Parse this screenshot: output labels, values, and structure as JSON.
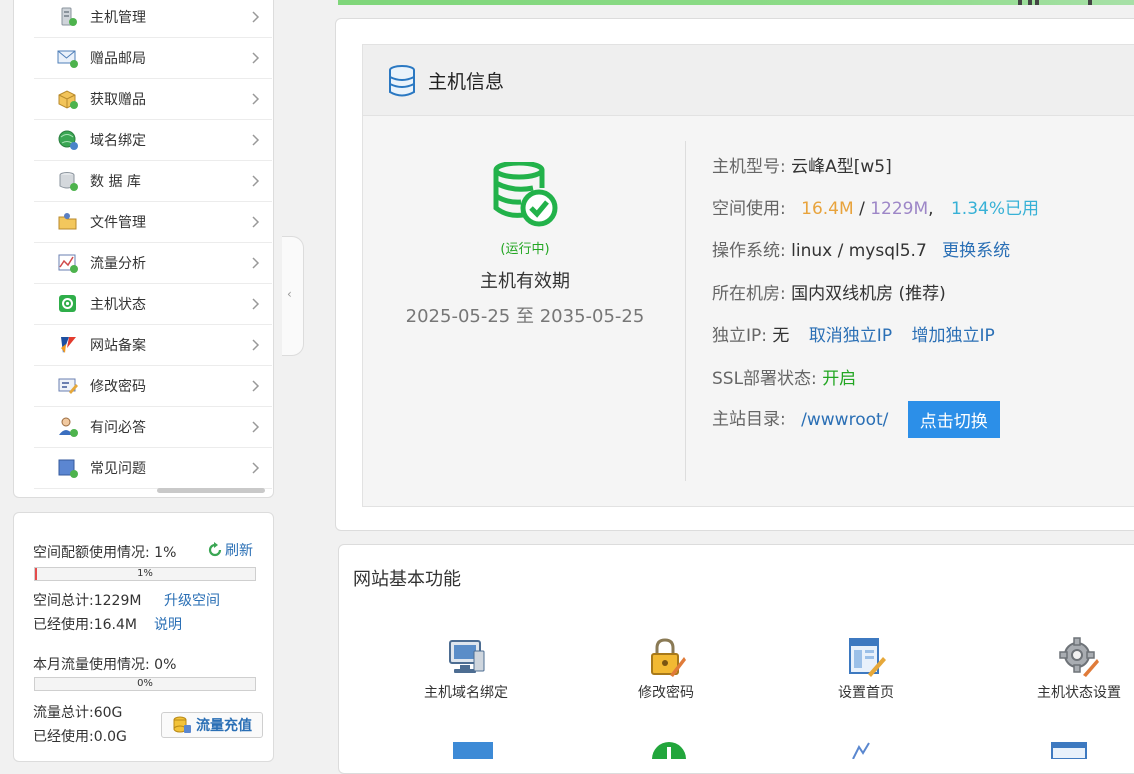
{
  "sidebar": {
    "items": [
      {
        "label": "主机管理",
        "icon": "server-icon"
      },
      {
        "label": "赠品邮局",
        "icon": "mail-icon"
      },
      {
        "label": "获取赠品",
        "icon": "gift-box-icon"
      },
      {
        "label": "域名绑定",
        "icon": "globe-icon"
      },
      {
        "label": "数 据 库",
        "icon": "database-icon"
      },
      {
        "label": "文件管理",
        "icon": "folder-icon"
      },
      {
        "label": "流量分析",
        "icon": "chart-icon"
      },
      {
        "label": "主机状态",
        "icon": "status-icon"
      },
      {
        "label": "网站备案",
        "icon": "record-icon"
      },
      {
        "label": "修改密码",
        "icon": "password-icon"
      },
      {
        "label": "有问必答",
        "icon": "support-user-icon"
      },
      {
        "label": "常见问题",
        "icon": "faq-icon"
      }
    ]
  },
  "quota": {
    "space_usage_label": "空间配额使用情况: 1%",
    "refresh_label": "刷新",
    "space_percent_text": "1%",
    "space_percent": 1,
    "space_total": "空间总计:1229M",
    "upgrade_label": "升级空间",
    "space_used": "已经使用:16.4M",
    "explain_label": "说明",
    "traffic_usage_label": "本月流量使用情况: 0%",
    "traffic_percent_text": "0%",
    "traffic_percent": 0,
    "traffic_total": "流量总计:60G",
    "traffic_used": "已经使用:0.0G",
    "recharge_label": "流量充值"
  },
  "host_info": {
    "title": "主机信息",
    "status": "(运行中)",
    "validity_title": "主机有效期",
    "validity_range": "2025-05-25 至 2035-05-25",
    "model_label": "主机型号:",
    "model_value": "云峰A型[w5]",
    "space_label": "空间使用:",
    "space_used": "16.4M",
    "space_sep": "/",
    "space_total": "1229M",
    "space_comma": ",",
    "space_percent": "1.34%已用",
    "os_label": "操作系统:",
    "os_value": "linux / mysql5.7",
    "os_change": "更换系统",
    "room_label": "所在机房:",
    "room_value": "国内双线机房 (推荐)",
    "ip_label": "独立IP:",
    "ip_value": "无",
    "ip_cancel": "取消独立IP",
    "ip_add": "增加独立IP",
    "ssl_label": "SSL部署状态:",
    "ssl_value": "开启",
    "root_label": "主站目录:",
    "root_value": "/wwwroot/",
    "switch_label": "点击切换",
    "colors": {
      "accent": "#2c8fe8",
      "running": "#22a622",
      "used": "#e8a33c",
      "total": "#9d86c7",
      "percent": "#37b1d6"
    }
  },
  "functions": {
    "title": "网站基本功能",
    "items": [
      {
        "label": "主机域名绑定",
        "icon": "computer-network-icon"
      },
      {
        "label": "修改密码",
        "icon": "lock-pencil-icon"
      },
      {
        "label": "设置首页",
        "icon": "page-edit-icon"
      },
      {
        "label": "主机状态设置",
        "icon": "gear-pencil-icon"
      }
    ]
  }
}
